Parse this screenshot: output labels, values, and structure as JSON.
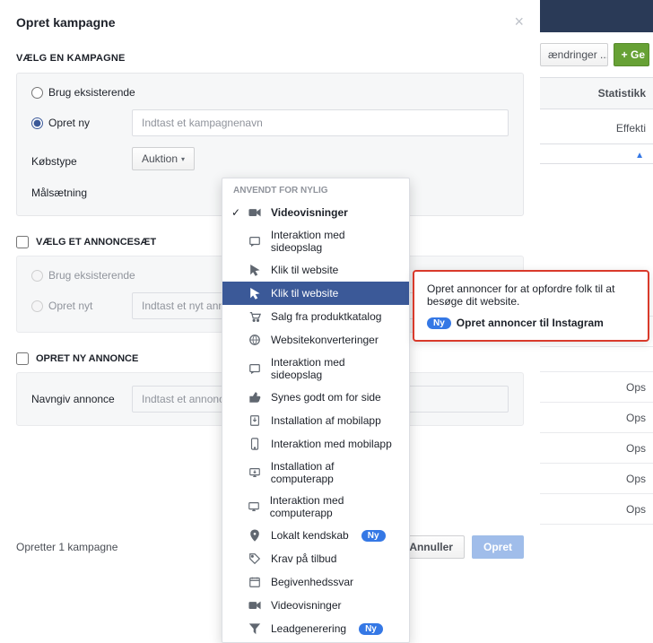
{
  "modal": {
    "title": "Opret kampagne",
    "section_choose": "VÆLG EN KAMPAGNE",
    "radio_existing": "Brug eksisterende",
    "radio_new": "Opret ny",
    "campaign_name_placeholder": "Indtast et kampagnenavn",
    "buy_type_label": "Købstype",
    "buy_type_value": "Auktion",
    "objective_label": "Målsætning",
    "section_adset": "VÆLG ET ANNONCESÆT",
    "adset_existing": "Brug eksisterende",
    "adset_new": "Opret nyt",
    "adset_name_placeholder": "Indtast et nyt annoncesætnavn",
    "section_ad": "OPRET NY ANNONCE",
    "ad_name_label": "Navngiv annonce",
    "ad_name_placeholder": "Indtast et annoncenavn",
    "footer_status": "Opretter 1 kampagne",
    "cancel": "Annuller",
    "submit": "Opret"
  },
  "dropdown": {
    "recent_header": "ANVENDT FOR NYLIG",
    "recent": [
      {
        "id": "videovisninger",
        "label": "Videovisninger",
        "icon": "video-icon",
        "checked": true,
        "bold": true
      },
      {
        "id": "interaktion-sideopslag",
        "label": "Interaktion med sideopslag",
        "icon": "post-icon"
      },
      {
        "id": "klik-website",
        "label": "Klik til website",
        "icon": "cursor-icon"
      }
    ],
    "all": [
      {
        "id": "klik-website-2",
        "label": "Klik til website",
        "icon": "cursor-icon",
        "selected": true
      },
      {
        "id": "salg-produktkatalog",
        "label": "Salg fra produktkatalog",
        "icon": "cart-icon"
      },
      {
        "id": "websitekonverteringer",
        "label": "Websitekonverteringer",
        "icon": "globe-icon"
      },
      {
        "id": "interaktion-sideopslag-2",
        "label": "Interaktion med sideopslag",
        "icon": "post-icon"
      },
      {
        "id": "synes-godt-om",
        "label": "Synes godt om for side",
        "icon": "like-icon"
      },
      {
        "id": "installation-mobilapp",
        "label": "Installation af mobilapp",
        "icon": "download-icon"
      },
      {
        "id": "interaktion-mobilapp",
        "label": "Interaktion med mobilapp",
        "icon": "mobile-icon"
      },
      {
        "id": "installation-computerapp",
        "label": "Installation af computerapp",
        "icon": "desktop-download-icon"
      },
      {
        "id": "interaktion-computerapp",
        "label": "Interaktion med computerapp",
        "icon": "desktop-icon"
      },
      {
        "id": "lokalt-kendskab",
        "label": "Lokalt kendskab",
        "icon": "pin-icon",
        "badge": "Ny"
      },
      {
        "id": "krav-tilbud",
        "label": "Krav på tilbud",
        "icon": "tag-icon"
      },
      {
        "id": "begivenhedssvar",
        "label": "Begivenhedssvar",
        "icon": "calendar-icon"
      },
      {
        "id": "videovisninger-2",
        "label": "Videovisninger",
        "icon": "video-icon"
      },
      {
        "id": "leadgenerering",
        "label": "Leadgenerering",
        "icon": "funnel-icon",
        "badge": "Ny"
      }
    ]
  },
  "callout": {
    "text": "Opret annoncer for at opfordre folk til at besøge dit website.",
    "badge": "Ny",
    "link": "Opret annoncer til Instagram"
  },
  "backdrop": {
    "changes_btn": "ændringer ...",
    "green_btn": "Ge",
    "stats_header": "Statistikk",
    "col_effekt": "Effekti",
    "cell_text": "Ops"
  }
}
